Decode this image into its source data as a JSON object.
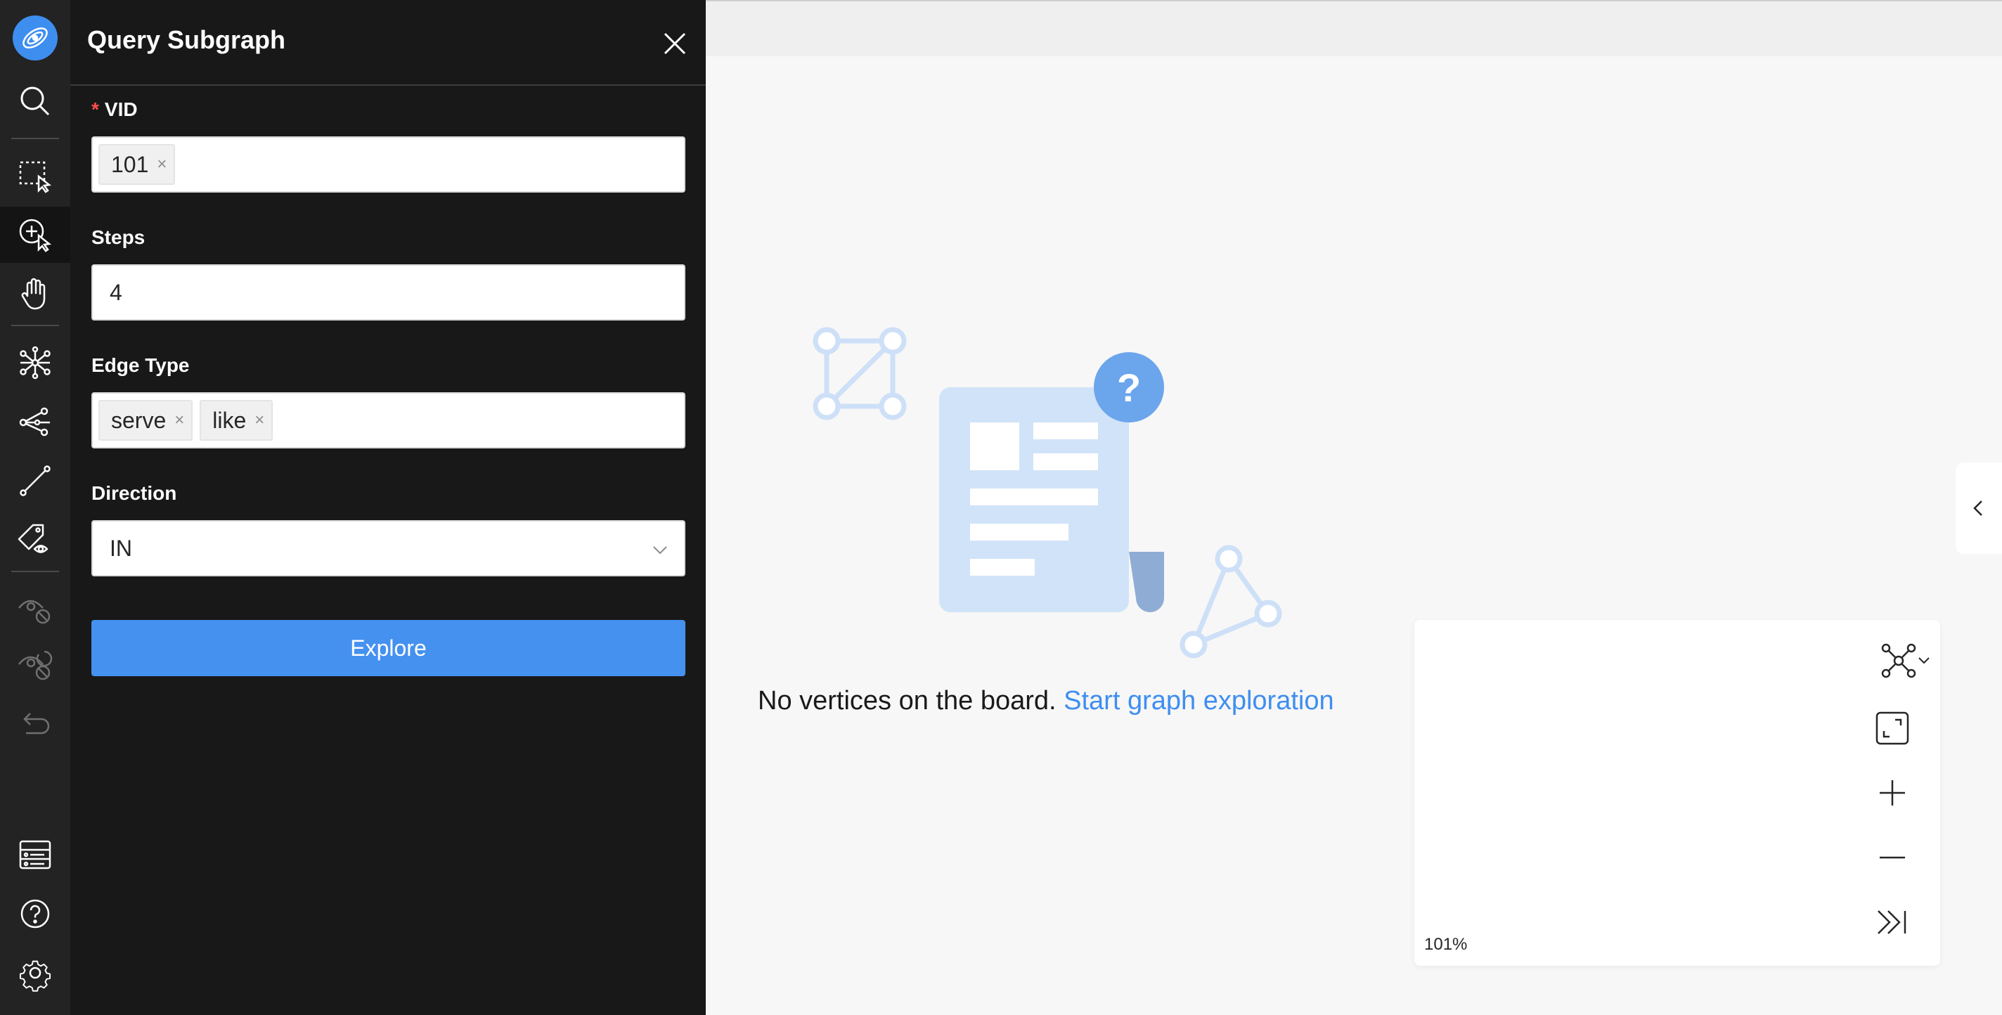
{
  "toolbar": {
    "logo": "nebula-logo-icon",
    "tools": [
      {
        "icon": "search-icon",
        "name": "search",
        "active": false
      },
      {
        "icon": "box-select-icon",
        "name": "box-select",
        "active": false
      },
      {
        "icon": "expand-node-icon",
        "name": "expand",
        "active": true
      },
      {
        "icon": "hand-pan-icon",
        "name": "pan",
        "active": false
      },
      {
        "icon": "graph-network-icon",
        "name": "common-neighbor",
        "active": false
      },
      {
        "icon": "share-graph-icon",
        "name": "find-path",
        "active": false
      },
      {
        "icon": "edge-line-icon",
        "name": "edge",
        "active": false
      },
      {
        "icon": "tag-eye-icon",
        "name": "property-view",
        "active": false
      },
      {
        "icon": "eye-hide-icon",
        "name": "hide",
        "disabled": true
      },
      {
        "icon": "eye-reset-icon",
        "name": "show-hidden",
        "disabled": true
      },
      {
        "icon": "undo-icon",
        "name": "undo",
        "disabled": true
      }
    ],
    "bottom": [
      {
        "icon": "list-icon",
        "name": "snapshot-list"
      },
      {
        "icon": "help-icon",
        "name": "help"
      },
      {
        "icon": "gear-icon",
        "name": "settings"
      }
    ]
  },
  "panel": {
    "title": "Query Subgraph",
    "vid": {
      "label": "VID",
      "required_mark": "*",
      "tags": [
        "101"
      ]
    },
    "steps": {
      "label": "Steps",
      "value": "4"
    },
    "edge_type": {
      "label": "Edge Type",
      "tags": [
        "serve",
        "like"
      ]
    },
    "direction": {
      "label": "Direction",
      "value": "IN"
    },
    "explore_label": "Explore"
  },
  "canvas": {
    "empty_text": "No vertices on the board.",
    "empty_link": "Start graph exploration",
    "zoom_level": "101%"
  },
  "colors": {
    "accent": "#3e8ef0",
    "button": "#4591f0",
    "toolbar_bg": "#232323",
    "panel_bg": "#181818",
    "required": "#ff4d4f"
  }
}
